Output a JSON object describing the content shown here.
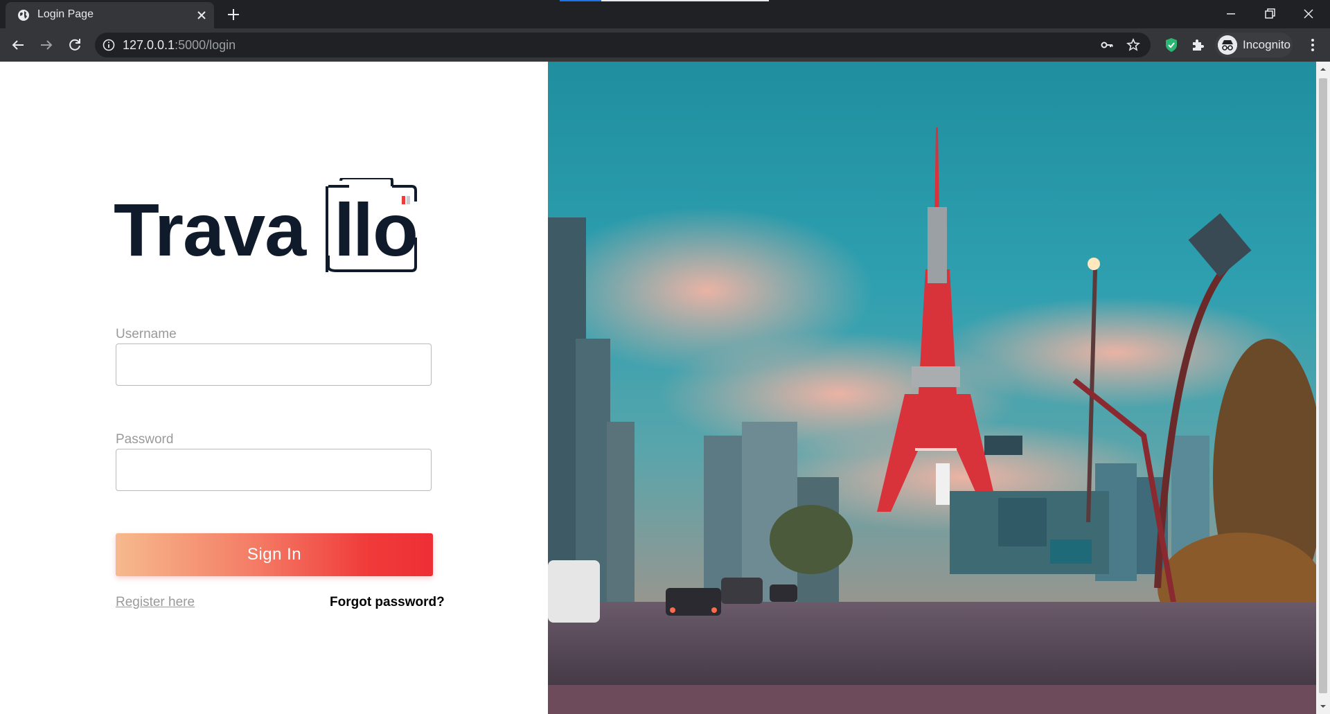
{
  "browser": {
    "tab": {
      "title": "Login Page"
    },
    "address": {
      "host": "127.0.0.1",
      "rest": ":5000/login"
    },
    "profile": {
      "label": "Incognito"
    }
  },
  "login": {
    "brand": "Travallo",
    "username": {
      "label": "Username",
      "value": "",
      "placeholder": ""
    },
    "password": {
      "label": "Password",
      "value": "",
      "placeholder": ""
    },
    "signin_label": "Sign In",
    "register_label": "Register here",
    "forgot_label": "Forgot password?"
  },
  "colors": {
    "logo_dark": "#0f1b2b",
    "logo_accent": "#ee3b3b",
    "button_gradient_start": "#f6b98d",
    "button_gradient_end": "#ee2f35"
  },
  "icons": [
    "globe-icon",
    "close-icon",
    "plus-icon",
    "minimize-icon",
    "restore-icon",
    "window-close-icon",
    "back-arrow-icon",
    "forward-arrow-icon",
    "reload-icon",
    "info-icon",
    "key-icon",
    "star-icon",
    "shield-extension-icon",
    "puzzle-icon",
    "incognito-icon",
    "kebab-menu-icon",
    "camera-frame-icon"
  ]
}
